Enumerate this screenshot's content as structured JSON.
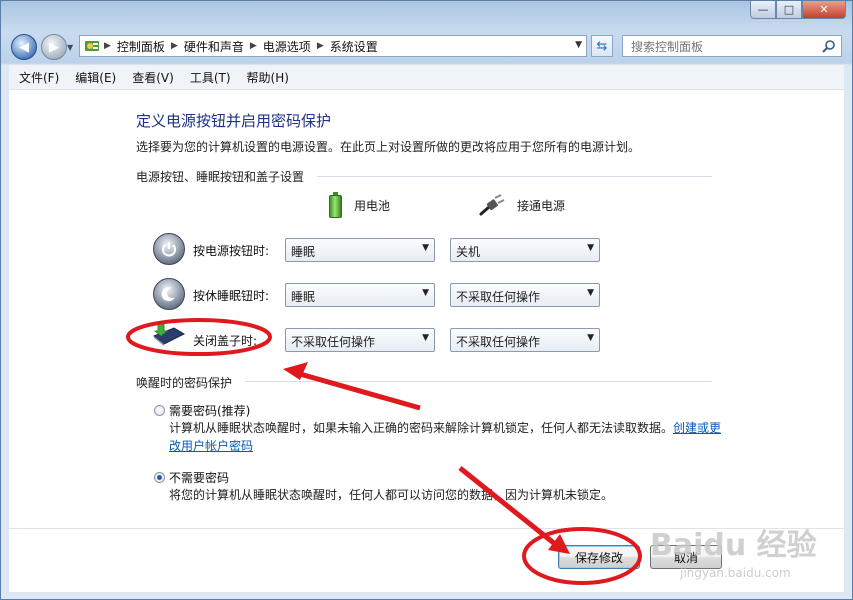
{
  "window": {
    "buttons": {
      "minimize": "—",
      "maximize": "□",
      "close": "✕"
    }
  },
  "navigation": {
    "back": "◀",
    "forward": "▶",
    "breadcrumb": [
      "控制面板",
      "硬件和声音",
      "电源选项",
      "系统设置"
    ],
    "search_placeholder": "搜索控制面板"
  },
  "menu": [
    "文件(F)",
    "编辑(E)",
    "查看(V)",
    "工具(T)",
    "帮助(H)"
  ],
  "page": {
    "title": "定义电源按钮并启用密码保护",
    "description": "选择要为您的计算机设置的电源设置。在此页上对设置所做的更改将应用于您所有的电源计划。",
    "section_power": "电源按钮、睡眠按钮和盖子设置",
    "col_battery": "用电池",
    "col_plugged": "接通电源",
    "rows": [
      {
        "label": "按电源按钮时:",
        "battery": "睡眠",
        "plugged": "关机"
      },
      {
        "label": "按休睡眠钮时:",
        "battery": "睡眠",
        "plugged": "不采取任何操作"
      },
      {
        "label": "关闭盖子时:",
        "battery": "不采取任何操作",
        "plugged": "不采取任何操作"
      }
    ],
    "section_password": "唤醒时的密码保护",
    "opt_require": "需要密码(推荐)",
    "opt_require_desc": "计算机从睡眠状态唤醒时，如果未输入正确的密码来解除计算机锁定，任何人都无法读取数据。",
    "opt_require_link": "创建或更改用户帐户密码",
    "opt_norequire": "不需要密码",
    "opt_norequire_desc": "将您的计算机从睡眠状态唤醒时，任何人都可以访问您的数据，因为计算机未锁定。",
    "selected_option": "no_password",
    "save": "保存修改",
    "cancel": "取消"
  },
  "watermark": {
    "brand": "Baidu 经验",
    "url": "jingyan.baidu.com"
  },
  "colors": {
    "title": "#1e3287",
    "annotation": "#e0191e",
    "link": "#0b58b8"
  }
}
